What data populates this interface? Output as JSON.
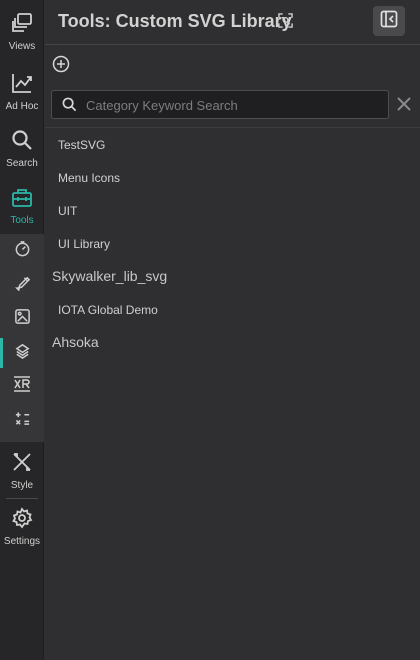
{
  "rail": {
    "items": [
      {
        "label": "Views",
        "icon": "views-icon"
      },
      {
        "label": "Ad Hoc",
        "icon": "chart-line-icon"
      },
      {
        "label": "Search",
        "icon": "search-icon"
      },
      {
        "label": "Tools",
        "icon": "toolbox-icon",
        "active": true
      }
    ],
    "subtools": [
      {
        "icon": "timer-icon"
      },
      {
        "icon": "paint-icon"
      },
      {
        "icon": "image-library-icon"
      },
      {
        "icon": "svg-library-icon",
        "active": true
      },
      {
        "icon": "xr-icon"
      },
      {
        "icon": "calculator-icon"
      }
    ],
    "bottom": [
      {
        "label": "Style",
        "icon": "style-icon"
      },
      {
        "label": "Settings",
        "icon": "gear-icon"
      }
    ]
  },
  "header": {
    "title": "Tools: Custom SVG Library"
  },
  "search": {
    "placeholder": "Category Keyword Search",
    "value": ""
  },
  "libraries": [
    {
      "name": "TestSVG",
      "size": "sm"
    },
    {
      "name": "Menu Icons",
      "size": "sm"
    },
    {
      "name": "UIT",
      "size": "sm"
    },
    {
      "name": "UI Library",
      "size": "sm"
    },
    {
      "name": "Skywalker_lib_svg",
      "size": "lg"
    },
    {
      "name": "IOTA Global Demo",
      "size": "sm"
    },
    {
      "name": "Ahsoka",
      "size": "lg"
    }
  ],
  "colors": {
    "accent": "#2bb6a6",
    "background": "#2f2f31",
    "rail": "#262628"
  }
}
